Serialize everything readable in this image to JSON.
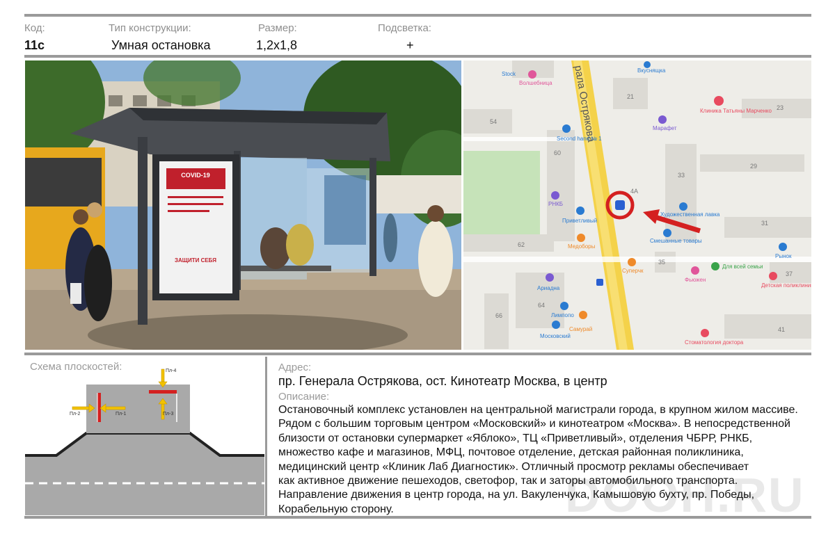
{
  "header": {
    "code_label": "Код:",
    "code_value": "11с",
    "type_label": "Тип конструкции:",
    "type_value": "Умная остановка",
    "size_label": "Размер:",
    "size_value": "1,2х1,8",
    "light_label": "Подсветка:",
    "light_value": "+"
  },
  "photo": {
    "poster_title": "COVID-19",
    "poster_text": "ЗАЩИТИ СЕБЯ"
  },
  "map": {
    "street": "рала Острякова",
    "places": {
      "stock": "Stock",
      "volshebnitsa": "Волшебница",
      "vkusnyashka": "Вкуснящка",
      "klinika": "Клиника Татьяны Марченко",
      "marafet": "Марафет",
      "second_hand": "Second hand № 1",
      "rnkb": "РНКБ",
      "privetlivyi": "Приветливый",
      "hudozh": "Художественная лавка",
      "smeshannye": "Смешанные товары",
      "medobory": "Медоборы",
      "superchk": "Суперчк",
      "fyuzhen": "Фьюжен",
      "dlya_semyi": "Для всей семьи",
      "rynok": "Рынок",
      "detskaya": "Детская поликлиника № 1",
      "ariadna": "Ариадна",
      "limpopo": "Лимпопо",
      "samurai": "Самурай",
      "moskovskiy": "Московский",
      "stomatologiya": "Стоматология доктора"
    },
    "houses": {
      "h21": "21",
      "h23": "23",
      "h54": "54",
      "h60": "60",
      "h29": "29",
      "h33": "33",
      "h31": "31",
      "h62": "62",
      "h35": "35",
      "h37": "37",
      "h64": "64",
      "h66": "66",
      "h41": "41",
      "h34a": "4А"
    }
  },
  "scheme": {
    "title": "Схема плоскостей:",
    "planes": {
      "p1": "Пл-1",
      "p2": "Пл-2",
      "p3": "Пл-3",
      "p4": "Пл-4"
    }
  },
  "address": {
    "label": "Адрес:",
    "value": "пр. Генерала Острякова, ост. Кинотеатр Москва, в центр"
  },
  "description": {
    "label": "Описание:",
    "lines": [
      "Остановочный комплекс установлен на центральной магистрали города, в крупном жилом массиве.",
      "Рядом с большим торговым центром «Московский» и кинотеатром «Москва». В непосредственной",
      "близости от остановки супермаркет «Яблоко», ТЦ «Приветливый», отделения ЧБРР, РНКБ,",
      "множество кафе и магазинов, МФЦ, почтовое отделение, детская районная поликлиника,",
      "медицинский центр «Клиник Лаб Диагностик». Отличный просмотр рекламы обеспечивает",
      "как активное движение пешеходов, светофор, так и заторы автомобильного транспорта.",
      "Направление движения в центр города, на ул. Вакуленчука, Камышовую бухту, пр. Победы,",
      "Корабельную сторону."
    ]
  },
  "watermark": "DOOH.RU",
  "colors": {
    "accent_red": "#d42020",
    "arrow_yellow": "#f2c200",
    "road_gray": "#a9a9a9",
    "divider_gray": "#9a9a9a"
  }
}
